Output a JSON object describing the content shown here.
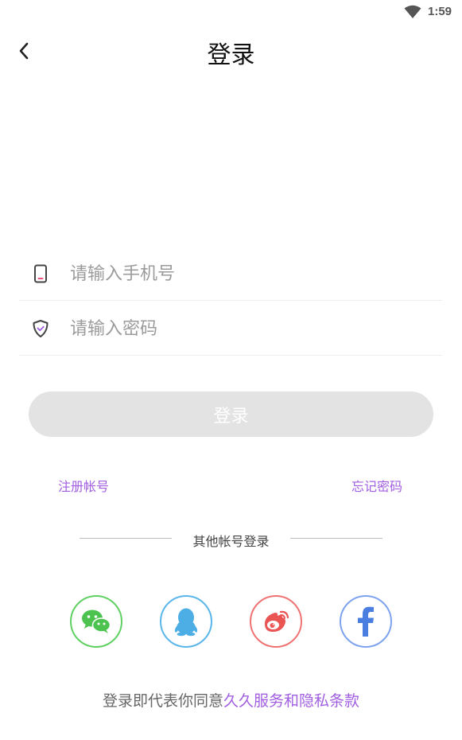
{
  "status_bar": {
    "time": "1:59",
    "wifi_icon": "wifi-icon"
  },
  "header": {
    "back_icon": "chevron-left-icon",
    "title": "登录"
  },
  "form": {
    "phone": {
      "icon": "phone-icon",
      "placeholder": "请输入手机号",
      "value": ""
    },
    "password": {
      "icon": "shield-icon",
      "placeholder": "请输入密码",
      "value": ""
    },
    "login_label": "登录"
  },
  "links": {
    "register": "注册帐号",
    "forgot_password": "忘记密码"
  },
  "other_login": {
    "label": "其他帐号登录",
    "providers": [
      {
        "name": "wechat",
        "icon": "wechat-icon",
        "color": "#5fd062"
      },
      {
        "name": "qq",
        "icon": "qq-icon",
        "color": "#5ab6ea"
      },
      {
        "name": "weibo",
        "icon": "weibo-icon",
        "color": "#f07272"
      },
      {
        "name": "facebook",
        "icon": "facebook-icon",
        "color": "#7ea3ee"
      }
    ]
  },
  "agreement": {
    "prefix": "登录即代表你同意",
    "link_text": "久久服务和隐私条款"
  },
  "colors": {
    "accent": "#a15ee0",
    "button_disabled": "#e3e3e3"
  }
}
